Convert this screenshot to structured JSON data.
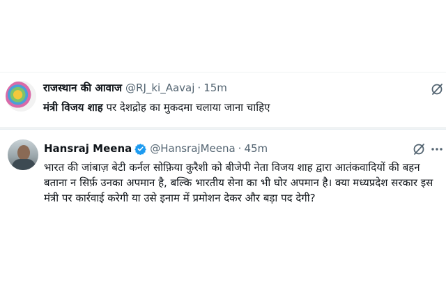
{
  "tweets": [
    {
      "display_name": "राजस्थान की आवाज",
      "handle": "@RJ_ki_Aavaj",
      "separator": "·",
      "time": "15m",
      "text_bold": "मंत्री विजय शाह",
      "text_rest": " पर देशद्रोह का मुकदमा चलाया जाना चाहिए"
    },
    {
      "display_name": "Hansraj Meena",
      "verified": true,
      "handle": "@HansrajMeena",
      "separator": "·",
      "time": "45m",
      "text": "भारत की जांबाज़ बेटी कर्नल सोफ़िया कुरैशी को बीजेपी नेता विजय शाह द्वारा आतंकवादियों की बहन बताना न सिर्फ़ उनका अपमान है, बल्कि भारतीय सेना का भी घोर अपमान है। क्या मध्यप्रदेश सरकार इस मंत्री पर कार्रवाई करेगी या उसे इनाम में प्रमोशन देकर और बड़ा पद देगी?"
    }
  ],
  "icons": {
    "grok": "grok-icon",
    "more": "more-options-icon",
    "verified": "verified-badge-icon"
  },
  "colors": {
    "accent": "#1d9bf0",
    "secondary_text": "#536471",
    "primary_text": "#0f1419"
  }
}
